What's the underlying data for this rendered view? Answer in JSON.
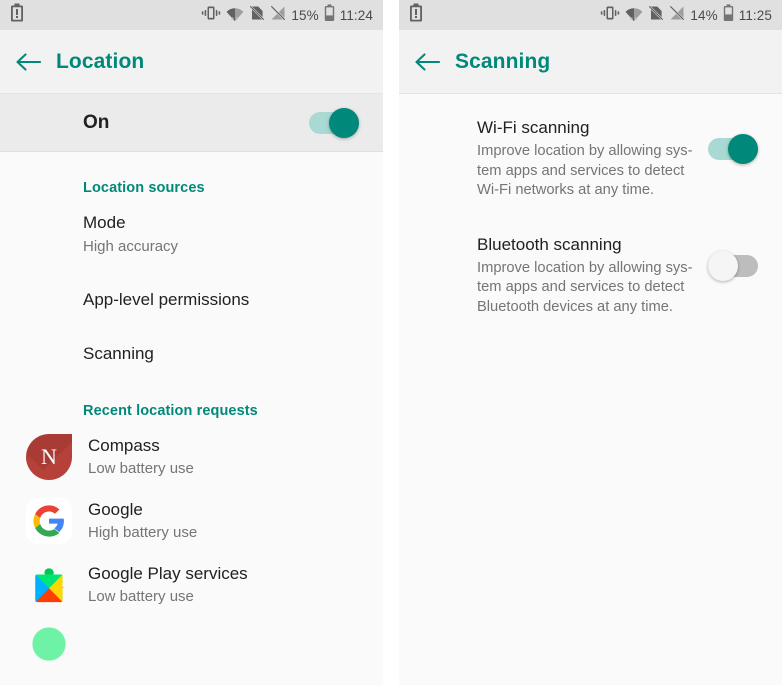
{
  "left_screen": {
    "statusbar": {
      "battery_alert_icon": "battery-alert-icon",
      "vibrate_icon": "vibrate-icon",
      "wifi_icon": "wifi-icon",
      "sim_off_icon": "sim-off-icon",
      "signal_off_icon": "cell-signal-off-icon",
      "battery_percent": "15%",
      "battery_icon": "battery-icon",
      "clock": "11:24"
    },
    "appbar": {
      "back_icon": "back-arrow-icon",
      "title": "Location"
    },
    "master": {
      "label": "On",
      "switch_state": "on"
    },
    "sections": [
      {
        "header": "Location sources",
        "rows": [
          {
            "primary": "Mode",
            "secondary": "High accuracy"
          },
          {
            "primary": "App-level permissions",
            "secondary": ""
          },
          {
            "primary": "Scanning",
            "secondary": ""
          }
        ]
      }
    ],
    "recent": {
      "header": "Recent location requests",
      "apps": [
        {
          "name": "Compass",
          "battery": "Low battery use",
          "icon": "compass-app-icon"
        },
        {
          "name": "Google",
          "battery": "High battery use",
          "icon": "google-app-icon"
        },
        {
          "name": "Google Play services",
          "battery": "Low battery use",
          "icon": "google-play-services-icon"
        },
        {
          "name": "",
          "battery": "",
          "icon": "google-maps-icon"
        }
      ]
    }
  },
  "right_screen": {
    "statusbar": {
      "battery_alert_icon": "battery-alert-icon",
      "vibrate_icon": "vibrate-icon",
      "wifi_icon": "wifi-icon",
      "sim_off_icon": "sim-off-icon",
      "signal_off_icon": "cell-signal-off-icon",
      "battery_percent": "14%",
      "battery_icon": "battery-icon",
      "clock": "11:25"
    },
    "appbar": {
      "back_icon": "back-arrow-icon",
      "title": "Scanning"
    },
    "rows": [
      {
        "primary": "Wi-Fi scanning",
        "secondary": "Improve location by allowing sys-\ntem apps and services to detect\nWi-Fi networks at any time.",
        "switch_state": "on"
      },
      {
        "primary": "Bluetooth scanning",
        "secondary": "Improve location by allowing sys-\ntem apps and services to detect\nBluetooth devices at any time.",
        "switch_state": "off"
      }
    ]
  },
  "colors": {
    "accent": "#00897b",
    "statusbar_bg": "#e0e0e0",
    "appbar_bg": "#f2f2f2",
    "content_bg": "#fafafa",
    "master_row_bg": "#ebebeb",
    "primary_text": "#212121",
    "secondary_text": "#757575"
  }
}
